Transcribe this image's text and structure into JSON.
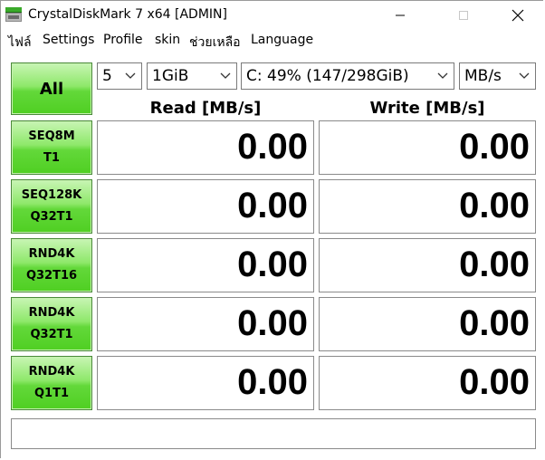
{
  "window": {
    "title": "CrystalDiskMark 7 x64 [ADMIN]"
  },
  "menu": {
    "items": [
      "ไฟล์",
      "Settings",
      "Profile",
      "skin",
      "ช่วยเหลือ",
      "Language"
    ]
  },
  "controls": {
    "all_label": "All",
    "count_value": "5",
    "size_value": "1GiB",
    "drive_value": "C: 49% (147/298GiB)",
    "unit_value": "MB/s"
  },
  "headers": {
    "read": "Read [MB/s]",
    "write": "Write [MB/s]"
  },
  "tests": [
    {
      "line1": "SEQ8M",
      "line2": "T1",
      "read": "0.00",
      "write": "0.00"
    },
    {
      "line1": "SEQ128K",
      "line2": "Q32T1",
      "read": "0.00",
      "write": "0.00"
    },
    {
      "line1": "RND4K",
      "line2": "Q32T16",
      "read": "0.00",
      "write": "0.00"
    },
    {
      "line1": "RND4K",
      "line2": "Q32T1",
      "read": "0.00",
      "write": "0.00"
    },
    {
      "line1": "RND4K",
      "line2": "Q1T1",
      "read": "0.00",
      "write": "0.00"
    }
  ],
  "comment": "",
  "colors": {
    "button_green": "#63d83a",
    "border": "#8a8a8a"
  }
}
